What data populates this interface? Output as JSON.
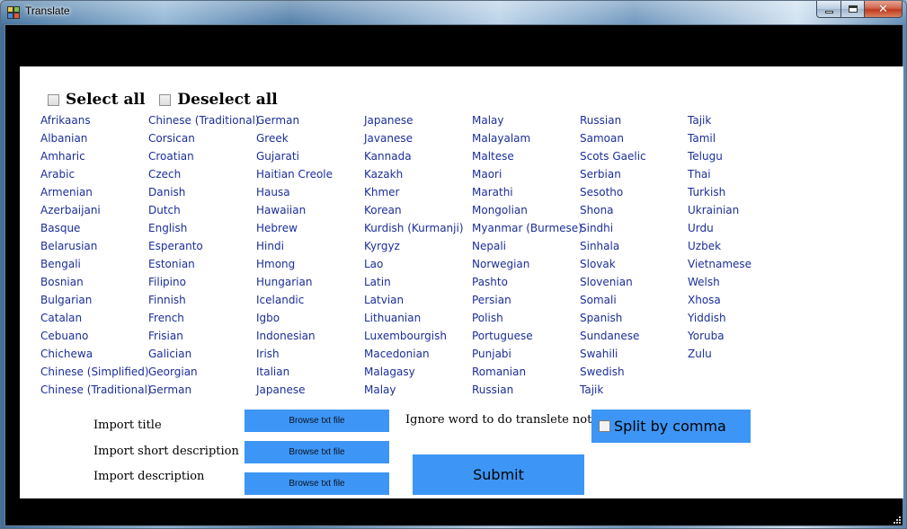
{
  "window": {
    "title": "Translate"
  },
  "select_all": {
    "label": "Select all",
    "checked": false
  },
  "deselect_all": {
    "label": "Deselect all",
    "checked": false
  },
  "language_columns": [
    [
      "Afrikaans",
      "Albanian",
      "Amharic",
      "Arabic",
      "Armenian",
      "Azerbaijani",
      "Basque",
      "Belarusian",
      "Bengali",
      "Bosnian",
      "Bulgarian",
      "Catalan",
      "Cebuano",
      "Chichewa",
      "Chinese (Simplified)",
      "Chinese (Traditional)"
    ],
    [
      "Chinese (Traditional)",
      "Corsican",
      "Croatian",
      "Czech",
      "Danish",
      "Dutch",
      "English",
      "Esperanto",
      "Estonian",
      "Filipino",
      "Finnish",
      "French",
      "Frisian",
      "Galician",
      "Georgian",
      "German"
    ],
    [
      "German",
      "Greek",
      "Gujarati",
      "Haitian Creole",
      "Hausa",
      "Hawaiian",
      "Hebrew",
      "Hindi",
      "Hmong",
      "Hungarian",
      "Icelandic",
      "Igbo",
      "Indonesian",
      "Irish",
      "Italian",
      "Japanese"
    ],
    [
      "Japanese",
      "Javanese",
      "Kannada",
      "Kazakh",
      "Khmer",
      "Korean",
      "Kurdish (Kurmanji)",
      "Kyrgyz",
      "Lao",
      "Latin",
      "Latvian",
      "Lithuanian",
      "Luxembourgish",
      "Macedonian",
      "Malagasy",
      "Malay"
    ],
    [
      "Malay",
      "Malayalam",
      "Maltese",
      "Maori",
      "Marathi",
      "Mongolian",
      "Myanmar (Burmese)",
      "Nepali",
      "Norwegian",
      "Pashto",
      "Persian",
      "Polish",
      "Portuguese",
      "Punjabi",
      "Romanian",
      "Russian"
    ],
    [
      "Russian",
      "Samoan",
      "Scots Gaelic",
      "Serbian",
      "Sesotho",
      "Shona",
      "Sindhi",
      "Sinhala",
      "Slovak",
      "Slovenian",
      "Somali",
      "Spanish",
      "Sundanese",
      "Swahili",
      "Swedish",
      "Tajik"
    ],
    [
      "Tajik",
      "Tamil",
      "Telugu",
      "Thai",
      "Turkish",
      "Ukrainian",
      "Urdu",
      "Uzbek",
      "Vietnamese",
      "Welsh",
      "Xhosa",
      "Yiddish",
      "Yoruba",
      "Zulu"
    ]
  ],
  "imports": {
    "title_label": "Import title",
    "short_description_label": "Import short description",
    "description_label": "Import description",
    "browse_label": "Browse txt file"
  },
  "ignore_label": "Ignore word to do translete not",
  "split_by_comma": {
    "label": "Split by comma",
    "checked": false
  },
  "submit_label": "Submit",
  "colors": {
    "accent": "#3d96f5",
    "link": "#1c2e9a",
    "panel": "#ffffff",
    "frame": "#000000"
  }
}
